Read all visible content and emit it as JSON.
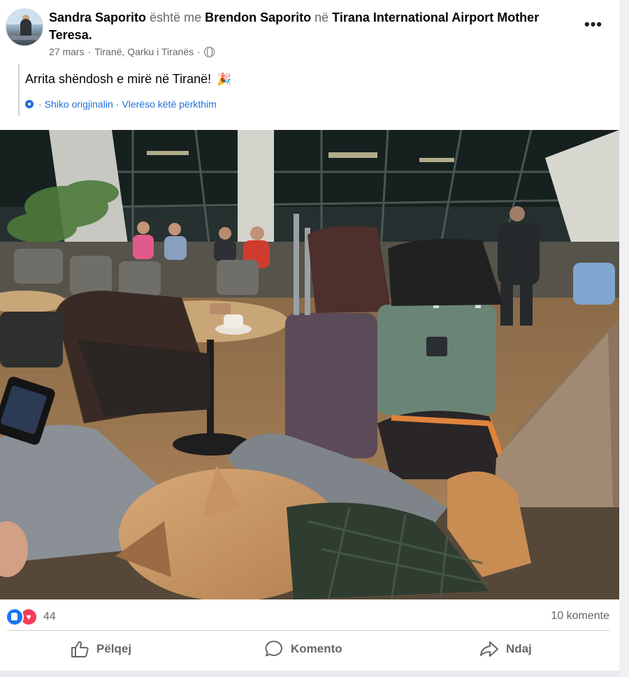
{
  "post": {
    "author": "Sandra Saporito",
    "with_word": "është me",
    "tagged": "Brendon Saporito",
    "in_word": "në",
    "location": "Tirana International Airport Mother Teresa",
    "date": "27 mars",
    "meta_sep": "·",
    "place": "Tiranë, Qarku i Tiranës",
    "text": "Arrita shëndosh e mirë në Tiranë!",
    "emoji": "🎉",
    "see_original": "Shiko origjinalin",
    "rate_translation": "Vlerëso këtë përkthim",
    "trans_sep": "·"
  },
  "reactions": {
    "count": "44",
    "comments": "10 komente"
  },
  "actions": {
    "like": "Pëlqej",
    "comment": "Komento",
    "share": "Ndaj"
  },
  "icons": {
    "more": "more-options-icon",
    "privacy": "globe-icon",
    "translate": "gear-icon",
    "like": "thumbs-up-icon",
    "comment": "comment-bubble-icon",
    "share": "share-arrow-icon"
  },
  "colors": {
    "link_blue": "#216fdb",
    "like_blue": "#1877f2",
    "love_red": "#f33e58",
    "secondary_text": "#65676b"
  }
}
